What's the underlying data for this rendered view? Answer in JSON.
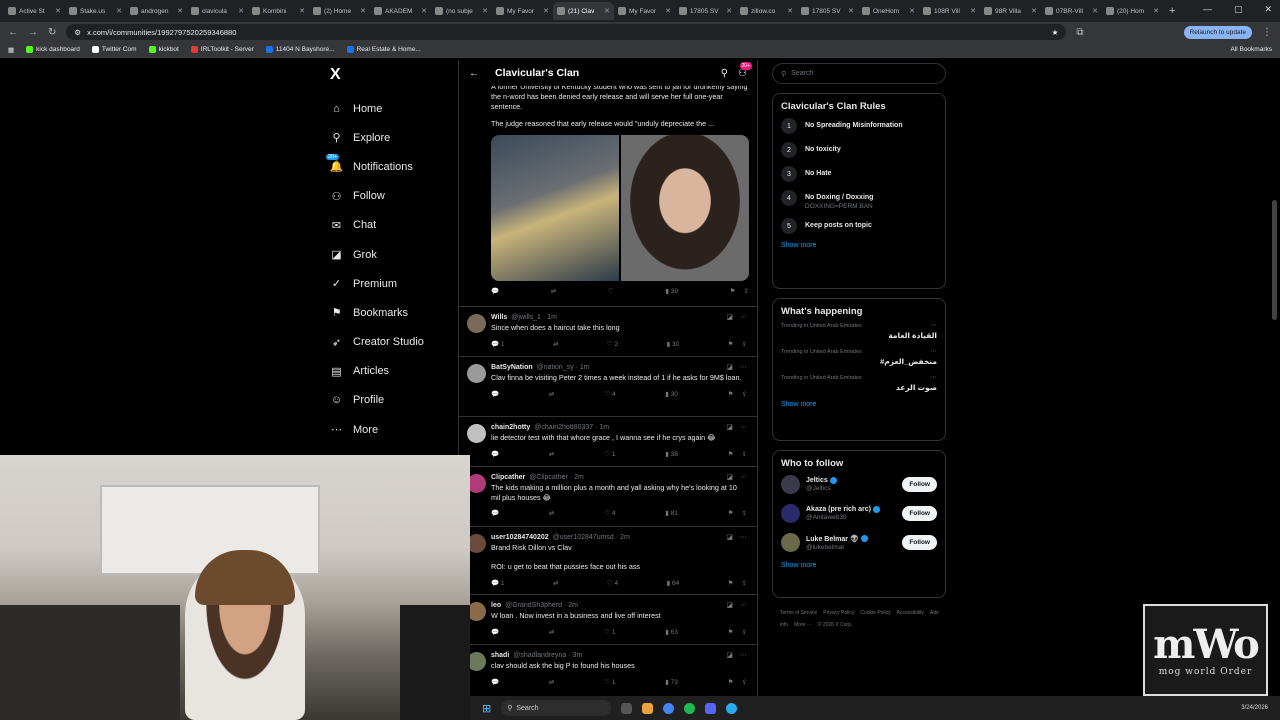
{
  "browser": {
    "tabs": [
      {
        "label": "Active St",
        "active": false
      },
      {
        "label": "Stake.us",
        "active": false
      },
      {
        "label": "androgen",
        "active": false
      },
      {
        "label": "clavicula",
        "active": false
      },
      {
        "label": "Kombini",
        "active": false
      },
      {
        "label": "(2) Home",
        "active": false
      },
      {
        "label": "AKADEM",
        "active": false
      },
      {
        "label": "(no subje",
        "active": false
      },
      {
        "label": "My Favor",
        "active": false
      },
      {
        "label": "(21) Clav",
        "active": true
      },
      {
        "label": "My Favor",
        "active": false
      },
      {
        "label": "17805 SV",
        "active": false
      },
      {
        "label": "zillow.co",
        "active": false
      },
      {
        "label": "17805 SV",
        "active": false
      },
      {
        "label": "OneHom",
        "active": false
      },
      {
        "label": "108R Vill",
        "active": false
      },
      {
        "label": "98R Villa",
        "active": false
      },
      {
        "label": "07BR-Vill",
        "active": false
      },
      {
        "label": "(20) Hom",
        "active": false
      }
    ],
    "url": "x.com/i/communities/1992797520259346880",
    "relaunch_label": "Relaunch to update",
    "bookmarks": [
      {
        "label": "kick dashboard",
        "color": "#53fc18"
      },
      {
        "label": "Twitter Com",
        "color": "#ffffff"
      },
      {
        "label": "kickbot",
        "color": "#53fc18"
      },
      {
        "label": "IRLToolkit - Server",
        "color": "#e53935"
      },
      {
        "label": "11404 N Bayshore...",
        "color": "#1a73e8"
      },
      {
        "label": "Real Estate & Home...",
        "color": "#1a73e8"
      }
    ],
    "all_bookmarks_label": "All Bookmarks"
  },
  "sidebar": {
    "logo": "X",
    "notif_badge": "20+",
    "items": [
      {
        "label": "Home",
        "icon": "home-icon",
        "glyph": "⌂"
      },
      {
        "label": "Explore",
        "icon": "search-icon",
        "glyph": "⚲"
      },
      {
        "label": "Notifications",
        "icon": "bell-icon",
        "glyph": "🔔"
      },
      {
        "label": "Follow",
        "icon": "person-add-icon",
        "glyph": "⚇"
      },
      {
        "label": "Chat",
        "icon": "mail-icon",
        "glyph": "✉"
      },
      {
        "label": "Grok",
        "icon": "grok-icon",
        "glyph": "◪"
      },
      {
        "label": "Premium",
        "icon": "x-premium-icon",
        "glyph": "✓"
      },
      {
        "label": "Bookmarks",
        "icon": "bookmark-icon",
        "glyph": "⚑"
      },
      {
        "label": "Creator Studio",
        "icon": "rocket-icon",
        "glyph": "➶"
      },
      {
        "label": "Articles",
        "icon": "document-icon",
        "glyph": "▤"
      },
      {
        "label": "Profile",
        "icon": "profile-icon",
        "glyph": "☺"
      },
      {
        "label": "More",
        "icon": "more-icon",
        "glyph": "⋯"
      }
    ]
  },
  "header": {
    "title": "Clavicular's Clan",
    "badge": "20+"
  },
  "main_post": {
    "text_line1": "A former University of Kentucky student who was sent to jail for drunkenly saying the n-word has been denied early release and will serve her full one-year sentence.",
    "text_line2": "The judge reasoned that early release would \"unduly depreciate the ...",
    "views": "39"
  },
  "replies": [
    {
      "name": "Wills",
      "handle": "@jwills_1 · 1m",
      "text": "Since when does a haircut take this long",
      "replies": "1",
      "likes": "2",
      "views": "30",
      "avatar": "#7a6a5a"
    },
    {
      "name": "BatSyNation",
      "handle": "@nation_sy · 1m",
      "text": "Clav finna be visiting Peter 2 times a week instead of 1 if he asks for 9M$ loan.",
      "replies": "",
      "likes": "4",
      "views": "30",
      "avatar": "#9a9a9a"
    },
    {
      "name": "chain2hotty",
      "handle": "@chain2hott80337 · 1m",
      "text": "lie detector test with that whore grace , I wanna see if he crys again 😂",
      "replies": "",
      "likes": "1",
      "views": "38",
      "avatar": "#c0c0c0"
    },
    {
      "name": "Clipcather",
      "handle": "@Clipcather · 2m",
      "text": "The kids making a million plus a month and yall asking why he's looking at 10 mil plus houses 😂",
      "replies": "",
      "likes": "4",
      "views": "81",
      "avatar": "#b03a7a"
    },
    {
      "name": "user10284740202",
      "handle": "@user102847umsd · 2m",
      "text": "Brand Risk Dillon vs Clav\n\nROI: u get to beat that pussies face out his ass",
      "replies": "1",
      "likes": "4",
      "views": "64",
      "avatar": "#6a4a3a"
    },
    {
      "name": "leo",
      "handle": "@GrandSh3pherd · 2m",
      "text": "W loan . Now invest in a business and live off interest",
      "replies": "",
      "likes": "1",
      "views": "63",
      "avatar": "#8a6a4a"
    },
    {
      "name": "shadi",
      "handle": "@shadlandreyna · 3m",
      "text": "clav should ask the big P to found his houses",
      "replies": "",
      "likes": "1",
      "views": "73",
      "avatar": "#6a7a5a"
    }
  ],
  "search": {
    "placeholder": "Search"
  },
  "rules": {
    "title": "Clavicular's Clan Rules",
    "items": [
      {
        "num": "1",
        "title": "No Spreading Misinformation",
        "sub": ""
      },
      {
        "num": "2",
        "title": "No toxicity",
        "sub": ""
      },
      {
        "num": "3",
        "title": "No Hate",
        "sub": ""
      },
      {
        "num": "4",
        "title": "No Doxing / Doxxing",
        "sub": "DOXXING=PERM BAN"
      },
      {
        "num": "5",
        "title": "Keep posts on topic",
        "sub": ""
      }
    ],
    "show_more": "Show more"
  },
  "happening": {
    "title": "What's happening",
    "items": [
      {
        "ctx": "Trending in United Arab Emirates",
        "topic": "القيادة العامة"
      },
      {
        "ctx": "Trending in United Arab Emirates",
        "topic": "#منخفض_العزم"
      },
      {
        "ctx": "Trending in United Arab Emirates",
        "topic": "صوت الرعد"
      }
    ],
    "show_more": "Show more"
  },
  "who_to_follow": {
    "title": "Who to follow",
    "items": [
      {
        "name": "Jeltics",
        "handle": "@Jeltics",
        "avatar": "#3a3a4a"
      },
      {
        "name": "Akaza (pre rich arc)",
        "handle": "@Anitaweb30",
        "avatar": "#2a2a6a"
      },
      {
        "name": "Luke Belmar 👽",
        "handle": "@lukebelmar",
        "avatar": "#6a6a4a"
      }
    ],
    "follow_label": "Follow",
    "show_more": "Show more"
  },
  "footer": {
    "links": [
      "Terms of Service",
      "Privacy Policy",
      "Cookie Policy",
      "Accessibility",
      "Ads info",
      "More ···",
      "© 2026 X Corp."
    ]
  },
  "taskbar": {
    "search_label": "Search",
    "date": "3/24/2026"
  },
  "watermark": {
    "big": "mWo",
    "small": "mog world Order"
  }
}
